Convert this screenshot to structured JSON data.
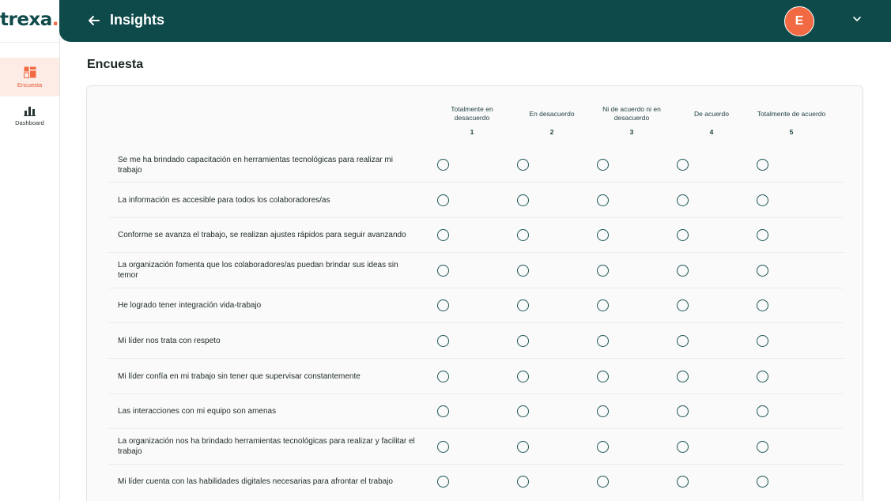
{
  "brand": {
    "logo_text": "trexa",
    "logo_dot": ".",
    "accent": "#f26a43",
    "primary": "#0f4a4a"
  },
  "sidebar": {
    "items": [
      {
        "label": "Encuesta",
        "icon": "survey-grid-icon",
        "active": true
      },
      {
        "label": "Dashboard",
        "icon": "bar-chart-icon",
        "active": false
      }
    ]
  },
  "header": {
    "title": "Insights",
    "back_icon": "arrow-left-icon",
    "avatar_initial": "E",
    "menu_icon": "chevron-down-icon"
  },
  "page": {
    "title": "Encuesta"
  },
  "survey": {
    "scale": [
      {
        "label": "Totalmente en desacuerdo",
        "value": "1"
      },
      {
        "label": "En desacuerdo",
        "value": "2"
      },
      {
        "label": "Ni de acuerdo ni en desacuerdo",
        "value": "3"
      },
      {
        "label": "De acuerdo",
        "value": "4"
      },
      {
        "label": "Totalmente de acuerdo",
        "value": "5"
      }
    ],
    "questions": [
      "Se me ha brindado capacitación en herramientas tecnológicas para realizar mi trabajo",
      "La información es accesible para todos los colaboradores/as",
      "Conforme se avanza el trabajo, se realizan ajustes rápidos para seguir avanzando",
      "La organización fomenta que los colaboradores/as puedan brindar sus ideas sin temor",
      "He logrado tener integración vida-trabajo",
      "Mi líder nos trata con respeto",
      "Mi líder confía en mi trabajo sin tener que supervisar constantemente",
      "Las interacciones con mi equipo son amenas",
      "La organización nos ha brindado herramientas tecnológicas para realizar y facilitar el trabajo",
      "Mi líder cuenta con las habilidades digitales necesarias para afrontar el trabajo"
    ]
  }
}
